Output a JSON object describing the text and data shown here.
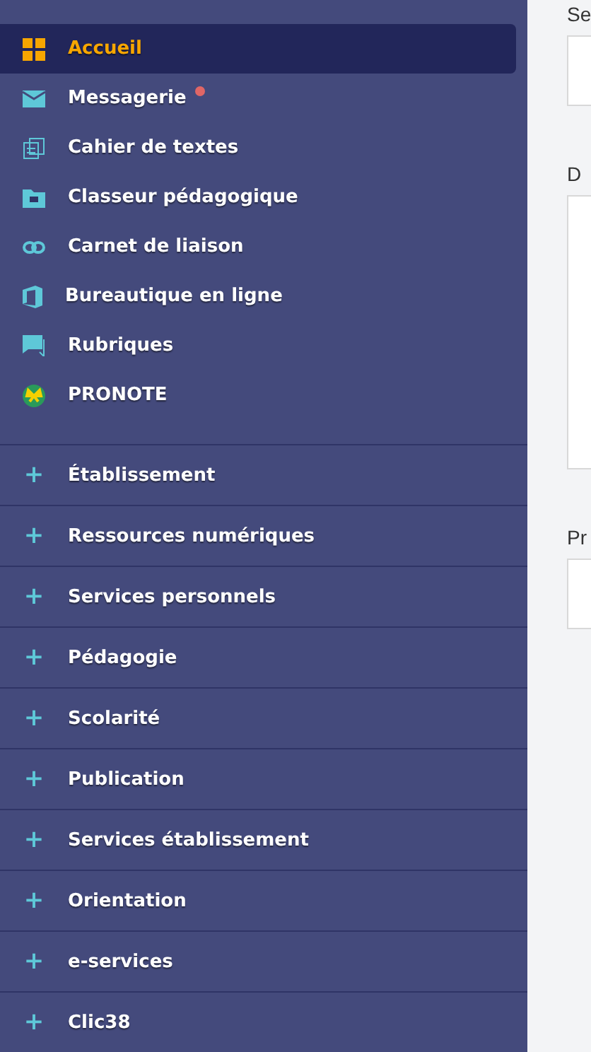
{
  "sidebar": {
    "items": [
      {
        "label": "Accueil",
        "selected": true,
        "unread": false
      },
      {
        "label": "Messagerie",
        "selected": false,
        "unread": true
      },
      {
        "label": "Cahier de textes",
        "selected": false,
        "unread": false
      },
      {
        "label": "Classeur pédagogique",
        "selected": false,
        "unread": false
      },
      {
        "label": "Carnet de liaison",
        "selected": false,
        "unread": false
      },
      {
        "label": "Bureautique en ligne",
        "selected": false,
        "unread": false
      },
      {
        "label": "Rubriques",
        "selected": false,
        "unread": false
      },
      {
        "label": "PRONOTE",
        "selected": false,
        "unread": false
      }
    ],
    "sections": [
      {
        "label": "+",
        "title": "Établissement"
      },
      {
        "label": "+",
        "title": "Ressources numériques"
      },
      {
        "label": "+",
        "title": "Services personnels"
      },
      {
        "label": "+",
        "title": "Pédagogie"
      },
      {
        "label": "+",
        "title": "Scolarité"
      },
      {
        "label": "+",
        "title": "Publication"
      },
      {
        "label": "+",
        "title": "Services établissement"
      },
      {
        "label": "+",
        "title": "Orientation"
      },
      {
        "label": "+",
        "title": "e-services"
      },
      {
        "label": "+",
        "title": "Clic38"
      }
    ]
  },
  "form": {
    "fields": [
      {
        "label": "Se",
        "kind": "input"
      },
      {
        "label": "D",
        "kind": "textarea"
      },
      {
        "label": "Pr",
        "kind": "input"
      }
    ]
  }
}
